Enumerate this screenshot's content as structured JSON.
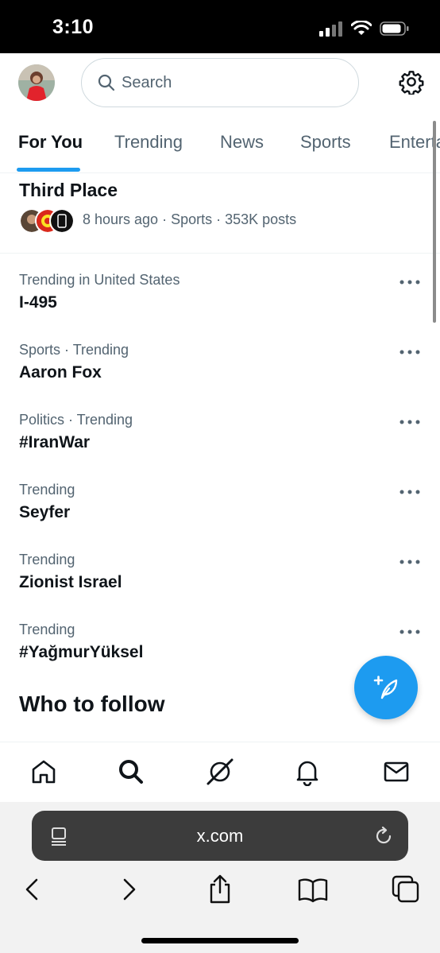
{
  "status_bar": {
    "time": "3:10"
  },
  "header": {
    "search_placeholder": "Search",
    "icons": [
      "avatar",
      "search-icon",
      "gear-icon"
    ]
  },
  "tabs": [
    {
      "label": "For You",
      "active": true
    },
    {
      "label": "Trending",
      "active": false
    },
    {
      "label": "News",
      "active": false
    },
    {
      "label": "Sports",
      "active": false
    },
    {
      "label": "Enterta",
      "active": false
    }
  ],
  "previous_item": {
    "title": "Third Place",
    "meta": "8 hours ago · Sports · 353K posts"
  },
  "trends": [
    {
      "meta": "Trending in United States",
      "title": "I-495"
    },
    {
      "meta": "Sports · Trending",
      "title": "Aaron Fox"
    },
    {
      "meta": "Politics · Trending",
      "title": "#IranWar"
    },
    {
      "meta": "Trending",
      "title": "Seyfer"
    },
    {
      "meta": "Trending",
      "title": "Zionist Israel"
    },
    {
      "meta": "Trending",
      "title": "#YağmurYüksel"
    }
  ],
  "who_to_follow": "Who to follow",
  "bottom_nav": [
    "home-icon",
    "search-icon",
    "grok-icon",
    "bell-icon",
    "mail-icon"
  ],
  "browser": {
    "url": "x.com",
    "toolbar": [
      "back-icon",
      "forward-icon",
      "share-icon",
      "bookmarks-icon",
      "tabs-icon"
    ]
  },
  "colors": {
    "accent": "#1d9bf0",
    "text_primary": "#0f1419",
    "text_secondary": "#536471"
  }
}
